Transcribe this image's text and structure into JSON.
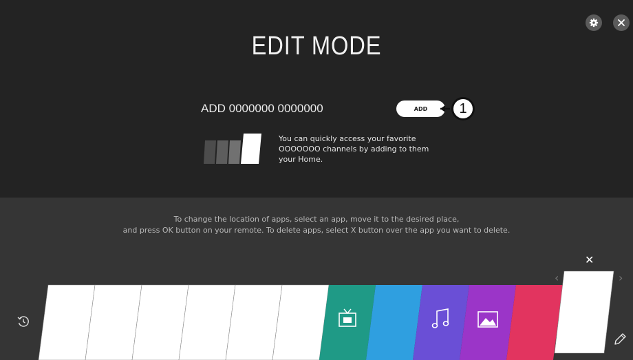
{
  "title": "EDIT MODE",
  "header": {
    "settings_icon": "gear-icon",
    "close_icon": "close-icon"
  },
  "add_section": {
    "label": "ADD 0000000 0000000",
    "button_label": "ADD",
    "callout_number": "1",
    "info_lines": [
      "You can quickly access your favorite",
      "OOOOOOO channels by adding to them",
      "your Home."
    ]
  },
  "instructions": {
    "line1": "To change the location of apps, select an app, move it to the desired place,",
    "line2": "and press OK button on your remote. To delete apps, select X button over the app you want to delete."
  },
  "app_strip": {
    "delete_label": "✕",
    "prev_arrow": "‹",
    "next_arrow": "›",
    "tiles": [
      {
        "name": "blank-1",
        "color": "#ffffff",
        "icon": ""
      },
      {
        "name": "blank-2",
        "color": "#ffffff",
        "icon": ""
      },
      {
        "name": "blank-3",
        "color": "#ffffff",
        "icon": ""
      },
      {
        "name": "blank-4",
        "color": "#ffffff",
        "icon": ""
      },
      {
        "name": "blank-5",
        "color": "#ffffff",
        "icon": ""
      },
      {
        "name": "blank-6",
        "color": "#ffffff",
        "icon": ""
      },
      {
        "name": "live-tv",
        "color": "#1f9a86",
        "icon": "tv-icon"
      },
      {
        "name": "blue",
        "color": "#2f9fe0",
        "icon": ""
      },
      {
        "name": "music",
        "color": "#6a4fd6",
        "icon": "music-note-icon"
      },
      {
        "name": "photo",
        "color": "#9b35c8",
        "icon": "photo-icon"
      },
      {
        "name": "red",
        "color": "#e2345f",
        "icon": ""
      },
      {
        "name": "selected",
        "color": "#ffffff",
        "icon": ""
      }
    ],
    "left_icon": "history-icon",
    "right_icon": "pencil-icon"
  }
}
